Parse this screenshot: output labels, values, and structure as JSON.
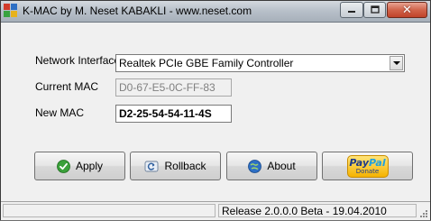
{
  "window": {
    "title": "K-MAC by M. Neset KABAKLI  -  www.neset.com",
    "icons": {
      "app": "app-grid-icon",
      "minimize": "minimize-icon",
      "maximize": "maximize-icon",
      "close": "close-icon"
    }
  },
  "form": {
    "network_interface_label": "Network Interface",
    "network_interface_value": "Realtek PCIe GBE Family Controller",
    "current_mac_label": "Current MAC",
    "current_mac_value": "D0-67-E5-0C-FF-83",
    "new_mac_label": "New MAC",
    "new_mac_value": "D2-25-54-54-11-4S"
  },
  "buttons": {
    "apply": {
      "label": "Apply",
      "icon": "check-circle-icon",
      "icon_color": "#3aa03a"
    },
    "rollback": {
      "label": "Rollback",
      "icon": "refresh-icon"
    },
    "about": {
      "label": "About",
      "icon": "info-globe-icon",
      "icon_color": "#2d6fc4"
    },
    "paypal": {
      "brand": "PayPal",
      "brand_first": "Pay",
      "brand_second": "Pal",
      "sub": "Donate",
      "icon": "paypal-donate-icon"
    }
  },
  "statusbar": {
    "release": "Release 2.0.0.0 Beta - 19.04.2010"
  }
}
